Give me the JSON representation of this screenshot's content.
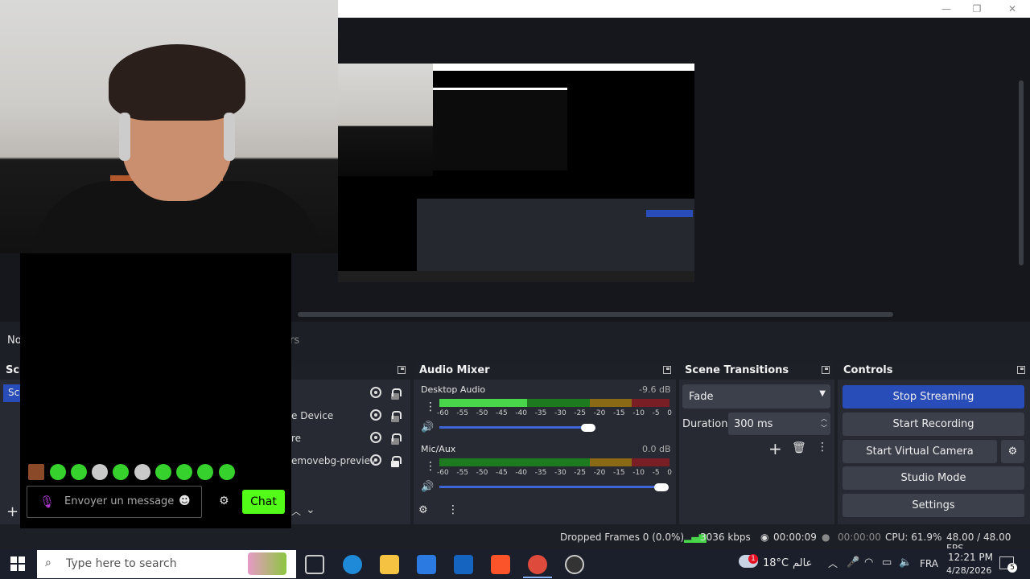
{
  "obs": {
    "docks": {
      "audio_mixer": "Audio Mixer",
      "scene_transitions": "Scene Transitions",
      "controls": "Controls",
      "scenes_partial": "Sc",
      "scenes_item_partial": "Sc",
      "toolbar_partial_left": "No",
      "toolbar_partial_right": "rs"
    },
    "sources": [
      {
        "label": "",
        "visible": true,
        "locked": false
      },
      {
        "label": "e Device",
        "visible": true,
        "locked": false
      },
      {
        "label": "re",
        "visible": true,
        "locked": false
      },
      {
        "label": "emovebg-previev",
        "visible": true,
        "locked": true
      }
    ],
    "mixer": {
      "channels": [
        {
          "name": "Desktop Audio",
          "db": "-9.6 dB",
          "level": 0.38,
          "volume": 0.66
        },
        {
          "name": "Mic/Aux",
          "db": "0.0 dB",
          "level": 0.0,
          "volume": 1.0
        }
      ],
      "ticks": [
        "-60",
        "-55",
        "-50",
        "-45",
        "-40",
        "-35",
        "-30",
        "-25",
        "-20",
        "-15",
        "-10",
        "-5",
        "0"
      ]
    },
    "transitions": {
      "selected": "Fade",
      "duration_label": "Duration",
      "duration_value": "300 ms"
    },
    "controls": {
      "stop_streaming": "Stop Streaming",
      "start_recording": "Start Recording",
      "start_virtual_camera": "Start Virtual Camera",
      "studio_mode": "Studio Mode",
      "settings": "Settings"
    },
    "status": {
      "dropped_frames": "Dropped Frames 0 (0.0%)",
      "bitrate": "3036 kbps",
      "stream_time": "00:00:09",
      "rec_time": "00:00:00",
      "cpu": "CPU: 61.9%",
      "fps": "48.00 / 48.00 FPS"
    }
  },
  "chat": {
    "placeholder": "Envoyer un message",
    "chat_button": "Chat"
  },
  "taskbar": {
    "search_placeholder": "Type here to search",
    "weather": "18°C",
    "weather_label": "عالم",
    "language": "FRA",
    "time": "12:21 PM",
    "date": "4/28/2026",
    "notification_count": "5",
    "weather_badge": "1"
  },
  "colors": {
    "accent_blue": "#284cb8",
    "kick_green": "#53fc18",
    "panel_bg": "#272a33"
  }
}
